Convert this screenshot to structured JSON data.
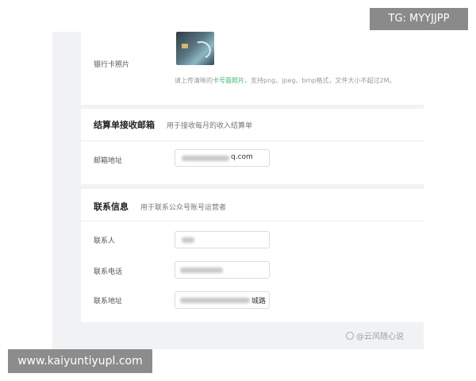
{
  "bank_section": {
    "photo_label": "银行卡照片",
    "hint_prefix": "请上传清晰的",
    "hint_accent": "卡号面照片",
    "hint_suffix": "，支持png、jpeg、bmp格式，文件大小不超过2M。"
  },
  "billing_section": {
    "title": "结算单接收邮箱",
    "subtitle": "用于接收每月的收入结算单",
    "email_label": "邮箱地址",
    "email_value_visible": "q.com"
  },
  "contact_section": {
    "title": "联系信息",
    "subtitle": "用于联系公众号账号运营者",
    "person_label": "联系人",
    "phone_label": "联系电话",
    "address_label": "联系地址",
    "address_value_visible": "城路"
  },
  "watermarks": {
    "top": "TG: MYYJJPP",
    "bottom": "www.kaiyuntiyupl.com",
    "wechat": "@云风随心说"
  },
  "colors": {
    "accent_green": "#3cb371",
    "background": "#f1f2f4"
  }
}
